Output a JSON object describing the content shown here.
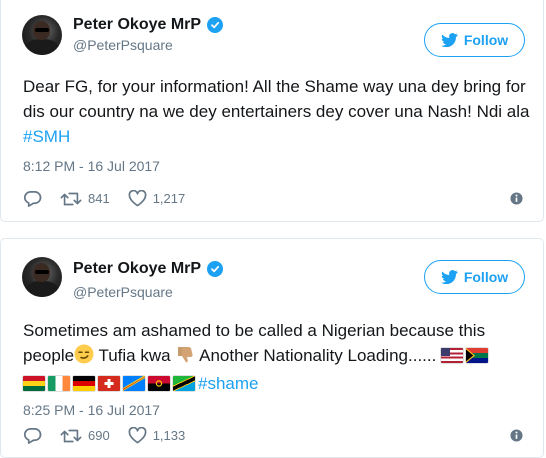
{
  "tweets": [
    {
      "author_name": "Peter Okoye MrP",
      "handle": "@PeterPsquare",
      "follow_label": "Follow",
      "text_main": "Dear FG, for your information! All the Shame way una dey bring for dis our country na we dey entertainers dey cover una Nash! Ndi ala ",
      "hashtag": "#SMH",
      "timestamp": "8:12 PM - 16 Jul 2017",
      "retweets": "841",
      "likes": "1,217"
    },
    {
      "author_name": "Peter Okoye MrP",
      "handle": "@PeterPsquare",
      "follow_label": "Follow",
      "text_part1": "Sometimes am ashamed to be called a Nigerian because this people",
      "text_part2": " Tufia kwa",
      "text_part3": " Another Nationality Loading...... ",
      "hashtag": "#shame",
      "timestamp": "8:25 PM - 16 Jul 2017",
      "retweets": "690",
      "likes": "1,133"
    }
  ],
  "icons": {
    "verified": "verified-badge-icon",
    "twitter_bird": "twitter-bird-icon",
    "reply": "reply-icon",
    "retweet": "retweet-icon",
    "like": "heart-icon",
    "info": "info-icon"
  },
  "colors": {
    "accent": "#1da1f2",
    "secondary_text": "#657786",
    "border": "#e1e8ed"
  }
}
